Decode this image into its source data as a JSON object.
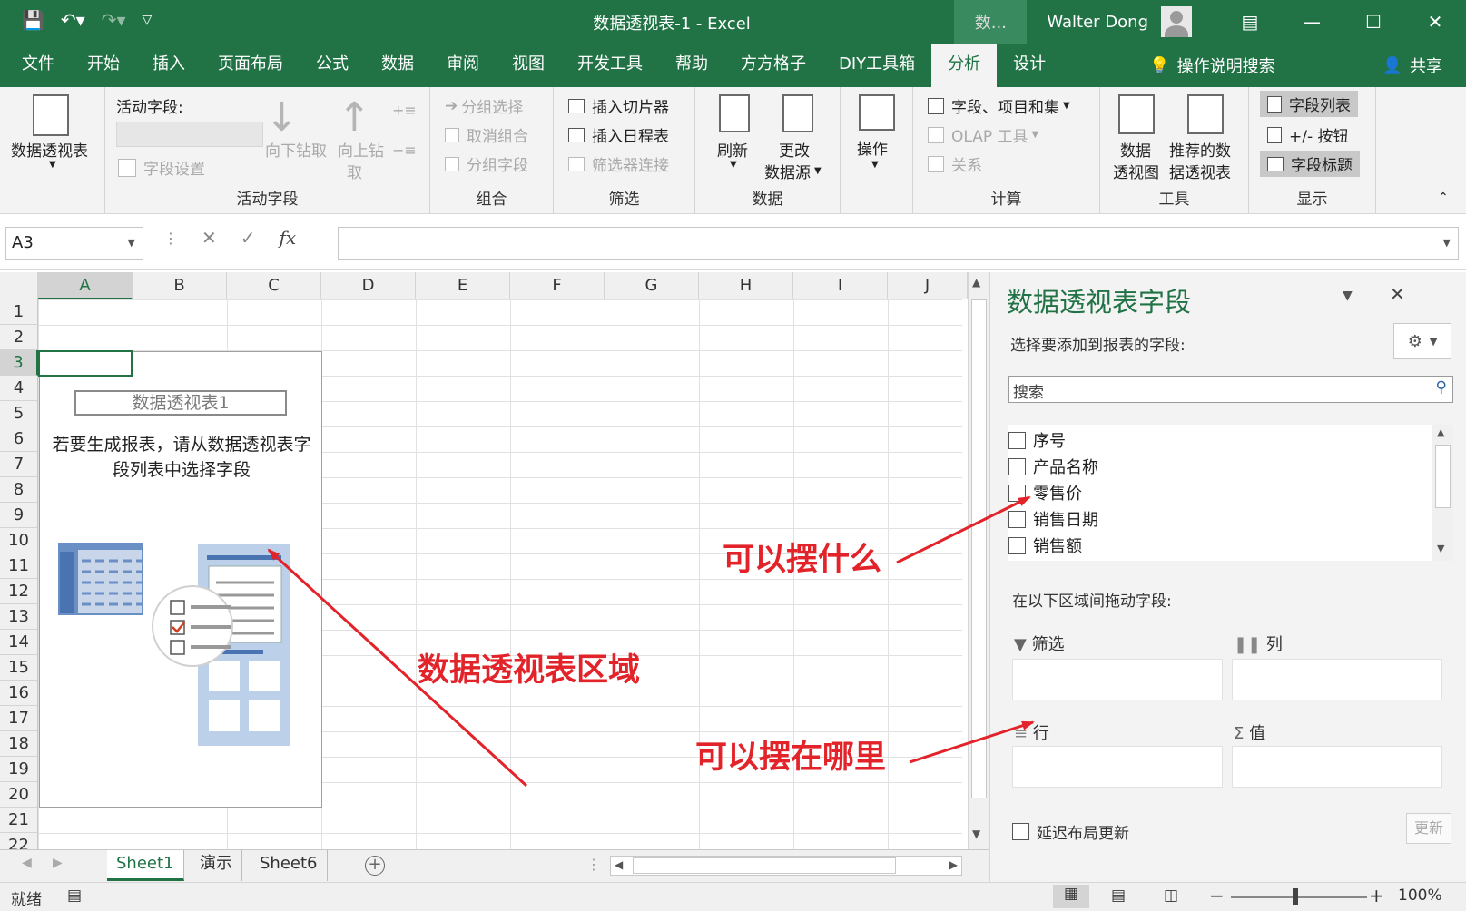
{
  "window": {
    "title": "数据透视表-1  -  Excel",
    "title_search": "数...",
    "user": "Walter Dong",
    "share": "共享",
    "tell_me": "操作说明搜索"
  },
  "tabs": [
    "文件",
    "开始",
    "插入",
    "页面布局",
    "公式",
    "数据",
    "审阅",
    "视图",
    "开发工具",
    "帮助",
    "方方格子",
    "DIY工具箱",
    "分析",
    "设计"
  ],
  "ribbon": {
    "pivot_table": "数据透视表",
    "active_field_label": "活动字段:",
    "field_settings": "字段设置",
    "drill_down": "向下钻取",
    "drill_up_1": "向上钻",
    "drill_up_2": "取",
    "group_active": "活动字段",
    "group_selection": "分组选择",
    "ungroup": "取消组合",
    "group_field": "分组字段",
    "group_group": "组合",
    "insert_slicer": "插入切片器",
    "insert_timeline": "插入日程表",
    "filter_connections": "筛选器连接",
    "group_filter": "筛选",
    "refresh": "刷新",
    "change_source_1": "更改",
    "change_source_2": "数据源",
    "group_data": "数据",
    "actions": "操作",
    "fields_items_sets": "字段、项目和集",
    "olap_tools": "OLAP 工具",
    "relationships": "关系",
    "group_calc": "计算",
    "pivot_chart_1": "数据",
    "pivot_chart_2": "透视图",
    "recommended_1": "推荐的数",
    "recommended_2": "据透视表",
    "group_tools": "工具",
    "field_list": "字段列表",
    "plus_minus": "+/- 按钮",
    "field_headers": "字段标题",
    "group_show": "显示"
  },
  "formula_bar": {
    "name_box": "A3",
    "fx": "fx",
    "value": ""
  },
  "columns": [
    "A",
    "B",
    "C",
    "D",
    "E",
    "F",
    "G",
    "H",
    "I",
    "J"
  ],
  "rows": [
    "1",
    "2",
    "3",
    "4",
    "5",
    "6",
    "7",
    "8",
    "9",
    "10",
    "11",
    "12",
    "13",
    "14",
    "15",
    "16",
    "17",
    "18",
    "19",
    "20",
    "21",
    "22"
  ],
  "pivot_placeholder": {
    "title": "数据透视表1",
    "message": "若要生成报表，请从数据透视表字段列表中选择字段"
  },
  "sheets": [
    "Sheet1",
    "演示",
    "Sheet6"
  ],
  "status": {
    "ready": "就绪",
    "zoom": "100%"
  },
  "panel": {
    "title": "数据透视表字段",
    "subtitle": "选择要添加到报表的字段:",
    "search_placeholder": "搜索",
    "fields": [
      "序号",
      "产品名称",
      "零售价",
      "销售日期",
      "销售额"
    ],
    "drag_label": "在以下区域间拖动字段:",
    "areas": {
      "filter": "筛选",
      "columns": "列",
      "rows": "行",
      "values": "值"
    },
    "defer": "延迟布局更新",
    "update": "更新"
  },
  "annotations": {
    "what": "可以摆什么",
    "where": "可以摆在哪里",
    "region": "数据透视表区域"
  },
  "colors": {
    "accent": "#217346",
    "annotation": "#e3232a"
  }
}
